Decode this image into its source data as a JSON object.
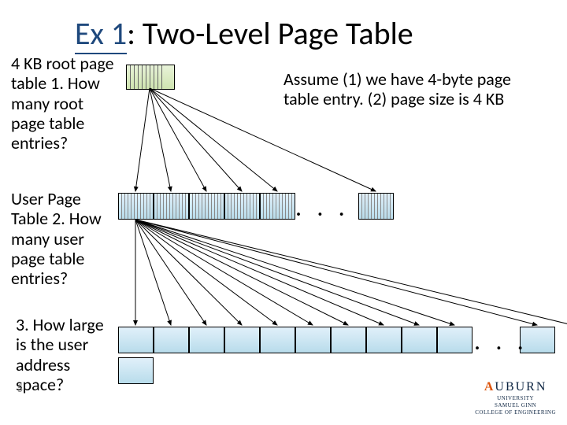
{
  "title": {
    "prefix": "Ex",
    "num": "1",
    "rest": ": Two-Level Page Table"
  },
  "notes": {
    "root": "4 KB root page table\n1. How many root page table entries?",
    "assume": "Assume  (1) we have 4-byte page table entry. (2) page size is 4 KB",
    "user": "User Page Table\n2. How many user page table entries?",
    "space": "3. How large is the user address space?"
  },
  "ellipsis": ". . .",
  "page_number": "5",
  "logo": {
    "brand_a": "A",
    "brand_rest": "UBURN",
    "sub1": "UNIVERSITY",
    "sub2": "SAMUEL GINN",
    "sub3": "COLLEGE OF ENGINEERING"
  },
  "diagram": {
    "root_entries": 10,
    "user_blocks": 6,
    "lines_per_user_block": 10,
    "address_cells": 12
  }
}
